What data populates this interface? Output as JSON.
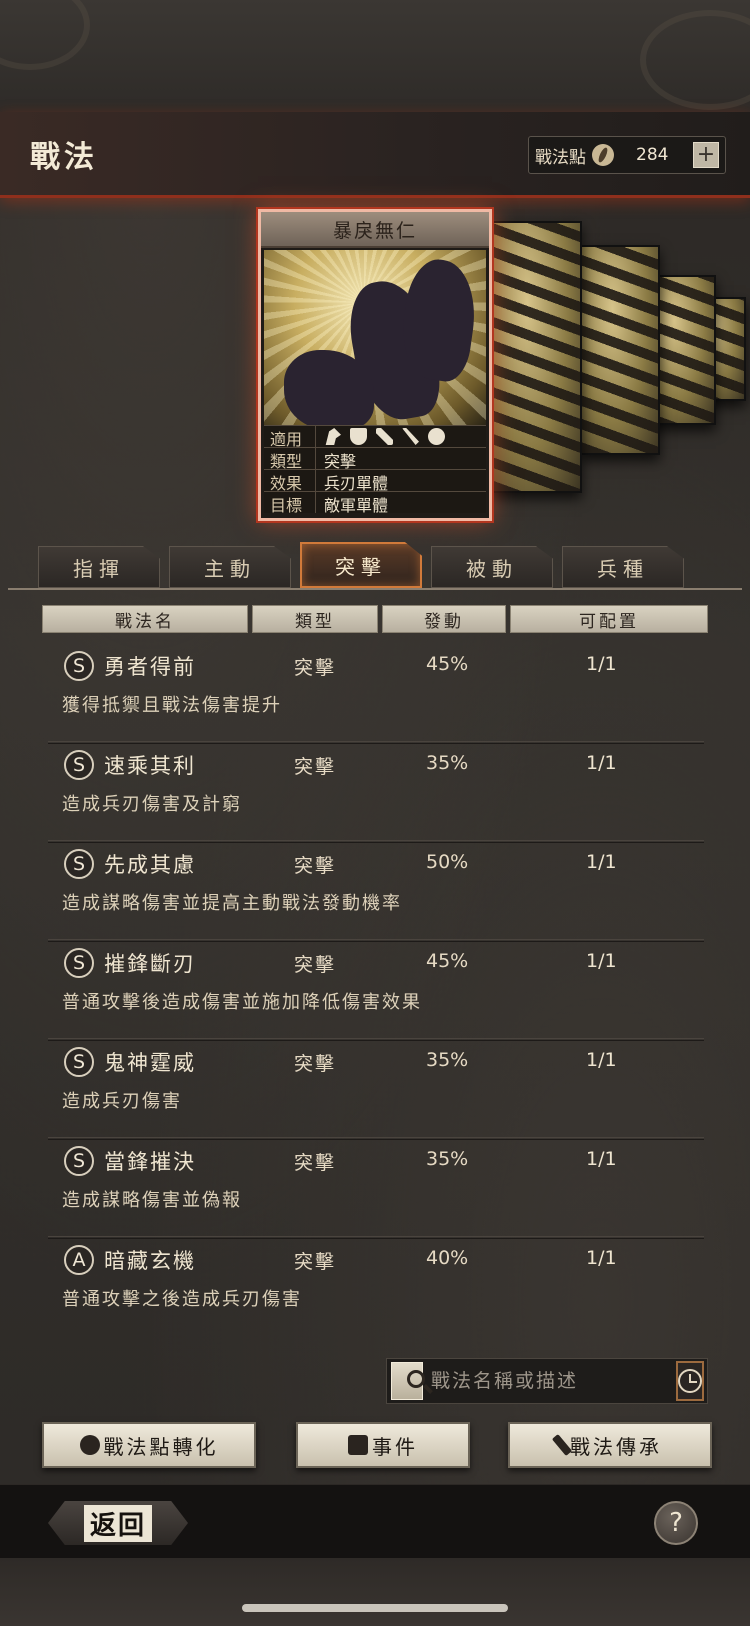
{
  "header": {
    "title": "戰法",
    "points_label": "戰法點",
    "points_value": "284",
    "add_label": "+"
  },
  "featured_card": {
    "name": "暴戾無仁",
    "rows": [
      {
        "key": "適用",
        "value": ""
      },
      {
        "key": "類型",
        "value": "突擊"
      },
      {
        "key": "效果",
        "value": "兵刃單體"
      },
      {
        "key": "目標",
        "value": "敵軍單體"
      }
    ],
    "applicable_icons": [
      "cavalry-icon",
      "shield-icon",
      "bow-icon",
      "spear-icon",
      "wheel-icon"
    ]
  },
  "tabs": [
    {
      "label": "指揮",
      "active": false
    },
    {
      "label": "主動",
      "active": false
    },
    {
      "label": "突擊",
      "active": true
    },
    {
      "label": "被動",
      "active": false
    },
    {
      "label": "兵種",
      "active": false
    }
  ],
  "table": {
    "columns": [
      "戰法名",
      "類型",
      "發動",
      "可配置"
    ],
    "rows": [
      {
        "grade": "S",
        "name": "勇者得前",
        "type": "突擊",
        "rate": "45%",
        "alloc": "1/1",
        "desc": "獲得抵禦且戰法傷害提升"
      },
      {
        "grade": "S",
        "name": "速乘其利",
        "type": "突擊",
        "rate": "35%",
        "alloc": "1/1",
        "desc": "造成兵刃傷害及計窮"
      },
      {
        "grade": "S",
        "name": "先成其慮",
        "type": "突擊",
        "rate": "50%",
        "alloc": "1/1",
        "desc": "造成謀略傷害並提高主動戰法發動機率"
      },
      {
        "grade": "S",
        "name": "摧鋒斷刃",
        "type": "突擊",
        "rate": "45%",
        "alloc": "1/1",
        "desc": "普通攻擊後造成傷害並施加降低傷害效果"
      },
      {
        "grade": "S",
        "name": "鬼神霆威",
        "type": "突擊",
        "rate": "35%",
        "alloc": "1/1",
        "desc": "造成兵刃傷害"
      },
      {
        "grade": "S",
        "name": "當鋒摧決",
        "type": "突擊",
        "rate": "35%",
        "alloc": "1/1",
        "desc": "造成謀略傷害並偽報"
      },
      {
        "grade": "A",
        "name": "暗藏玄機",
        "type": "突擊",
        "rate": "40%",
        "alloc": "1/1",
        "desc": "普通攻擊之後造成兵刃傷害"
      }
    ]
  },
  "search": {
    "placeholder": "戰法名稱或描述"
  },
  "actions": {
    "convert_label": "戰法點轉化",
    "events_label": "事件",
    "inherit_label": "戰法傳承"
  },
  "footer": {
    "back_label": "返回",
    "help_label": "?"
  },
  "colors": {
    "accent_red": "#b3361f",
    "active_tab_border": "#d17a3a",
    "button_face": "#efe9db"
  }
}
